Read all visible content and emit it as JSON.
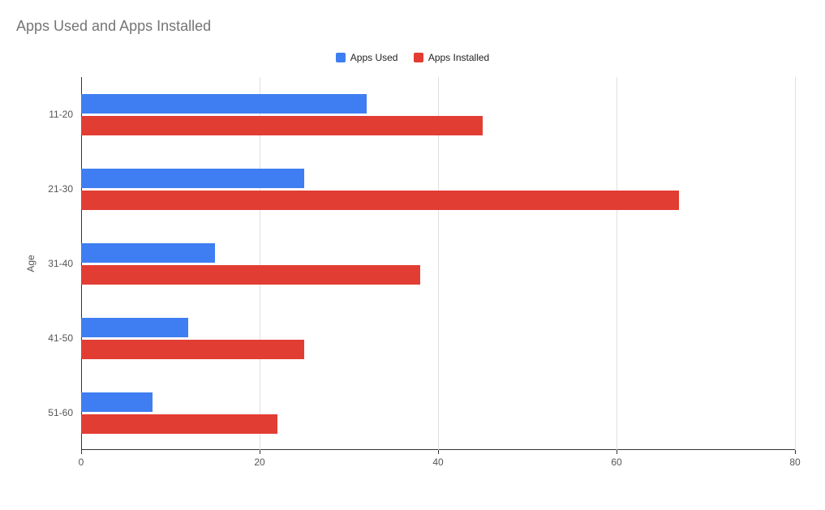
{
  "chart_data": {
    "type": "bar",
    "orientation": "horizontal",
    "title": "Apps Used and Apps Installed",
    "ylabel": "Age",
    "xlabel": "",
    "xlim": [
      0,
      80
    ],
    "x_ticks": [
      0,
      20,
      40,
      60,
      80
    ],
    "categories": [
      "11-20",
      "21-30",
      "31-40",
      "41-50",
      "51-60"
    ],
    "series": [
      {
        "name": "Apps Used",
        "color": "#3f7ef2",
        "values": [
          32,
          25,
          15,
          12,
          8
        ]
      },
      {
        "name": "Apps Installed",
        "color": "#e23d33",
        "values": [
          45,
          67,
          38,
          25,
          22
        ]
      }
    ],
    "legend_position": "top"
  }
}
